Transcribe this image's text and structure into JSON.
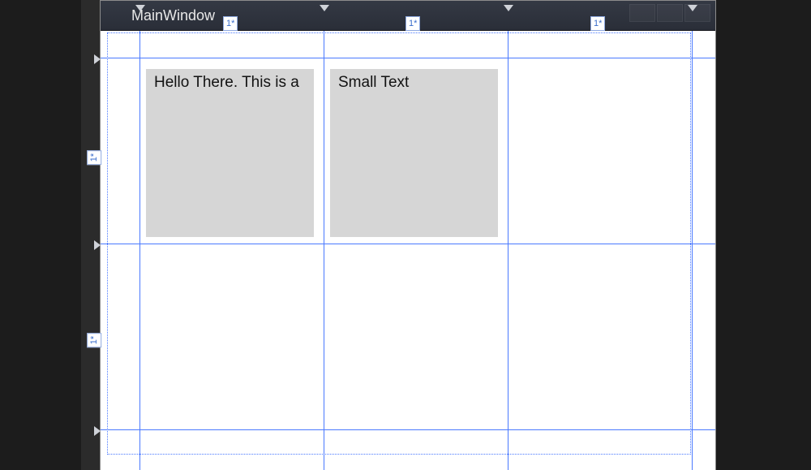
{
  "window": {
    "title": "MainWindow"
  },
  "grid": {
    "columns": [
      "1*",
      "1*",
      "1*"
    ],
    "rows": [
      "1*",
      "1*"
    ]
  },
  "blocks": {
    "b0": {
      "text": "Hello There. This is a"
    },
    "b1": {
      "text": "Small Text"
    }
  }
}
